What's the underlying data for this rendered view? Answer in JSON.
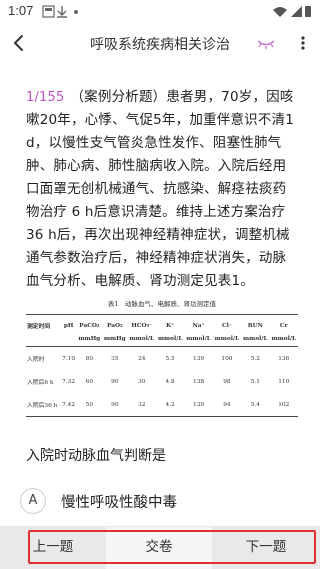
{
  "status_bar": {
    "time": "1:07"
  },
  "header": {
    "title": "呼吸系统疾病相关诊治"
  },
  "question": {
    "index": "1/155",
    "text": "（案例分析题）患者男，70岁，因咳嗽20年，心悸、气促5年，加重伴意识不清1 d，以慢性支气管炎急性发作、阻塞性肺气肿、肺心病、肺性脑病收入院。入院后经用口面罩无创机械通气、抗感染、解痉祛痰药物治疗 6 h后意识清楚。维持上述方案治疗36 h后，再次出现神经精神症状，调整机械通气参数治疗后，神经精神症状消失，动脉血气分析、电解质、肾功测定见表1。"
  },
  "table": {
    "caption": "表1　动脉血气、电解质、肾功测定值",
    "headers": [
      "测定时间",
      "pH",
      "PaCO₂",
      "PaO₂",
      "HCO₃⁻",
      "K⁺",
      "Na⁺",
      "Cl⁻",
      "BUN",
      "Cr"
    ],
    "units": [
      "",
      "",
      "mmHg",
      "mmHg",
      "mmol/L",
      "mmol/L",
      "mmol/L",
      "mmol/L",
      "mmol/L",
      "mmol/L"
    ],
    "rows": [
      [
        "入院时",
        "7.10",
        "80",
        "35",
        "24",
        "5.5",
        "139",
        "100",
        "5.2",
        "136"
      ],
      [
        "入院后6 h",
        "7.32",
        "60",
        "90",
        "30",
        "4.8",
        "138",
        "98",
        "5.1",
        "110"
      ],
      [
        "入院后36 h",
        "7.42",
        "50",
        "90",
        "32",
        "4.2",
        "139",
        "94",
        "5.4",
        "102"
      ]
    ]
  },
  "sub_question": "入院时动脉血气判断是",
  "options": [
    {
      "letter": "A",
      "text": "慢性呼吸性酸中毒"
    }
  ],
  "bottom_bar": {
    "prev": "上一题",
    "submit": "交卷",
    "next": "下一题"
  },
  "colors": {
    "index": "#c04fc4",
    "highlight": "#e03030",
    "eye_icon": "#c67bd6"
  }
}
